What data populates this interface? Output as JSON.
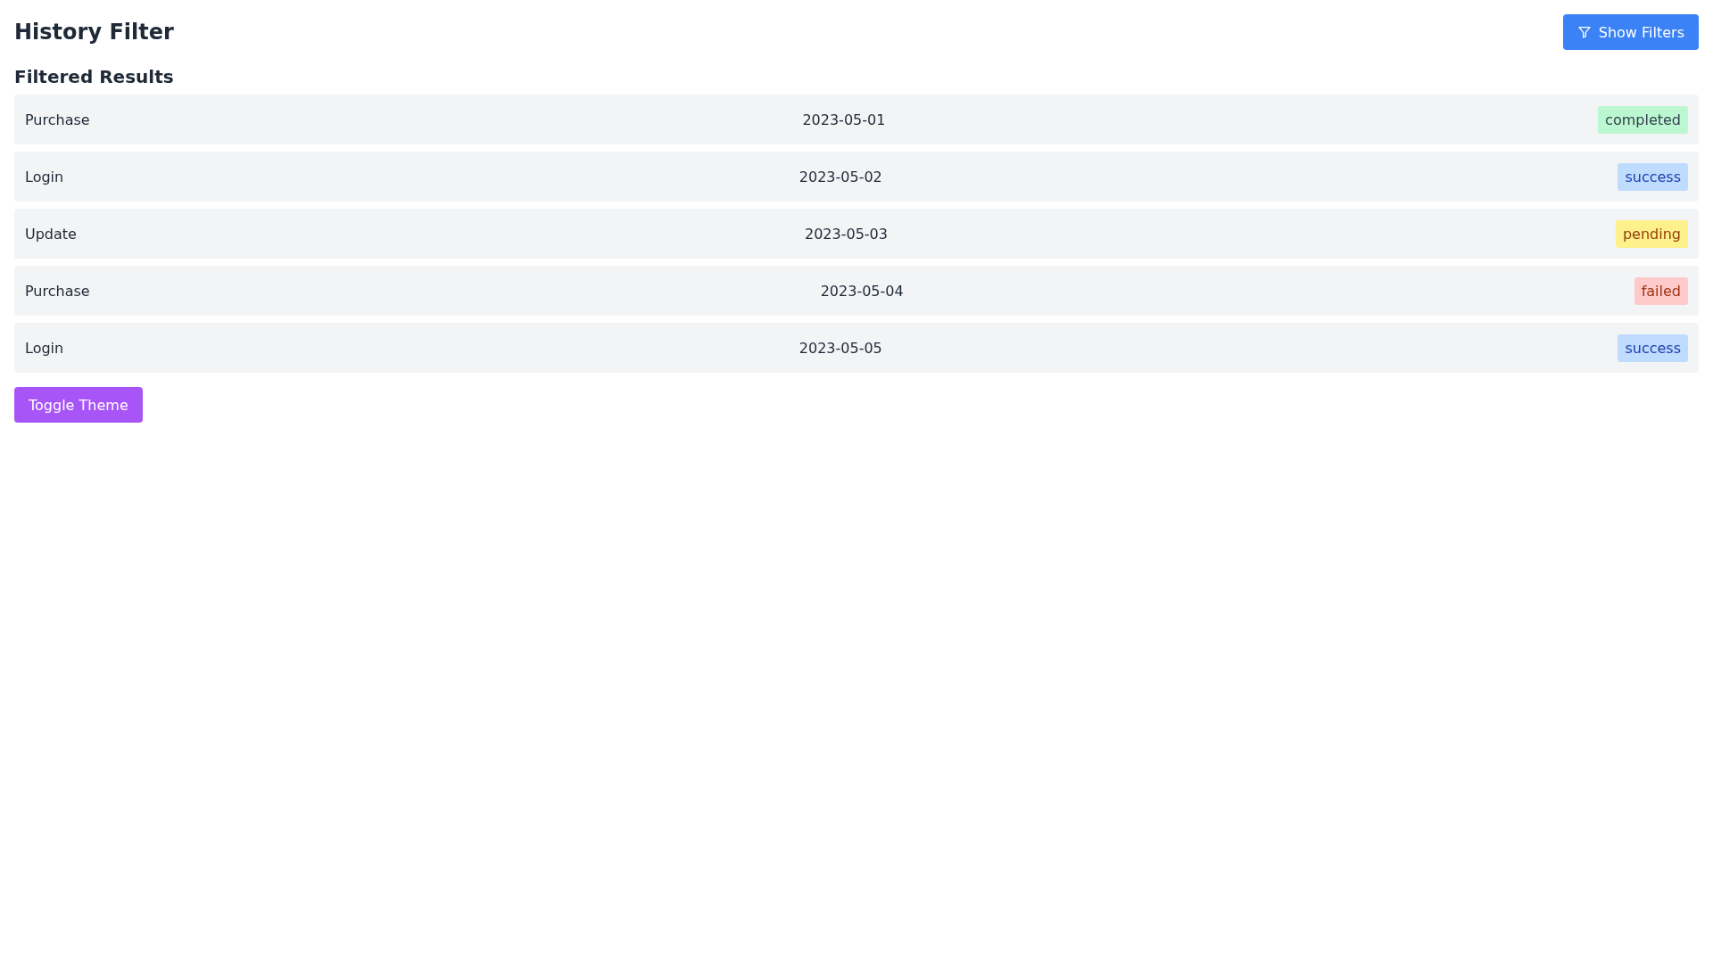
{
  "header": {
    "title": "History Filter",
    "filter_button": "Show Filters"
  },
  "results": {
    "heading": "Filtered Results",
    "rows": [
      {
        "action": "Purchase",
        "date": "2023-05-01",
        "status": "completed",
        "kind": "completed"
      },
      {
        "action": "Login",
        "date": "2023-05-02",
        "status": "success",
        "kind": "success"
      },
      {
        "action": "Update",
        "date": "2023-05-03",
        "status": "pending",
        "kind": "pending"
      },
      {
        "action": "Purchase",
        "date": "2023-05-04",
        "status": "failed",
        "kind": "failed"
      },
      {
        "action": "Login",
        "date": "2023-05-05",
        "status": "success",
        "kind": "success"
      }
    ]
  },
  "theme_button": "Toggle Theme"
}
